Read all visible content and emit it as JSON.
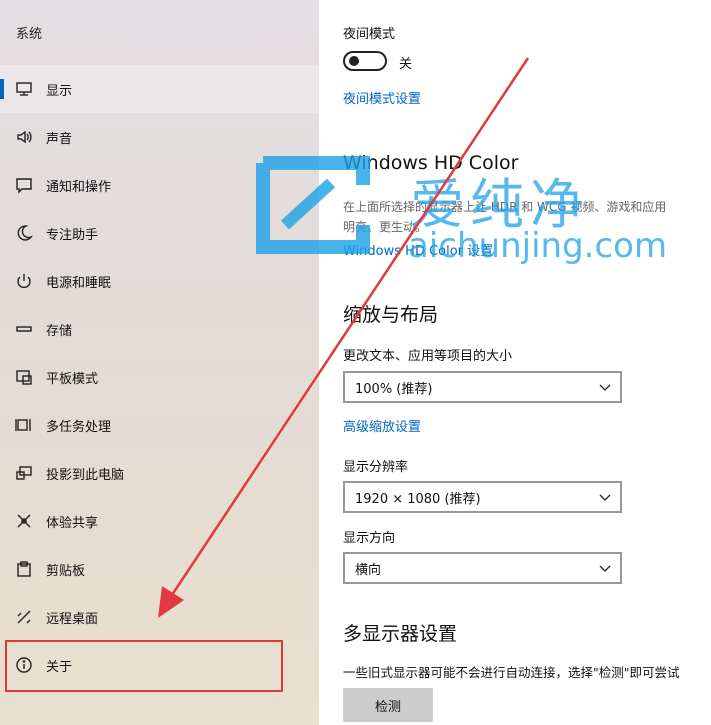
{
  "sidebar": {
    "title": "系统",
    "items": [
      {
        "label": "显示",
        "icon": "monitor-icon"
      },
      {
        "label": "声音",
        "icon": "speaker-icon"
      },
      {
        "label": "通知和操作",
        "icon": "notification-icon"
      },
      {
        "label": "专注助手",
        "icon": "moon-icon"
      },
      {
        "label": "电源和睡眠",
        "icon": "power-icon"
      },
      {
        "label": "存储",
        "icon": "storage-icon"
      },
      {
        "label": "平板模式",
        "icon": "tablet-icon"
      },
      {
        "label": "多任务处理",
        "icon": "multitask-icon"
      },
      {
        "label": "投影到此电脑",
        "icon": "project-icon"
      },
      {
        "label": "体验共享",
        "icon": "share-icon"
      },
      {
        "label": "剪贴板",
        "icon": "clipboard-icon"
      },
      {
        "label": "远程桌面",
        "icon": "remote-desktop-icon"
      },
      {
        "label": "关于",
        "icon": "info-icon"
      }
    ],
    "active_index": 0
  },
  "main": {
    "night_light": {
      "label": "夜间模式",
      "state_label": "关",
      "settings_link": "夜间模式设置"
    },
    "hd_color": {
      "heading": "Windows HD Color",
      "description_line1": "在上面所选择的显示器上让 HDR 和 WCG 视频、游戏和应用",
      "description_line2": "明亮、更生动。",
      "settings_link": "Windows HD Color 设置"
    },
    "scale_layout": {
      "heading": "缩放与布局",
      "text_size_label": "更改文本、应用等项目的大小",
      "text_size_value": "100% (推荐)",
      "advanced_link": "高级缩放设置",
      "resolution_label": "显示分辨率",
      "resolution_value": "1920 × 1080 (推荐)",
      "orientation_label": "显示方向",
      "orientation_value": "横向"
    },
    "multi_display": {
      "heading": "多显示器设置",
      "description": "一些旧式显示器可能不会进行自动连接，选择\"检测\"即可尝试",
      "detect_button": "检测"
    }
  },
  "watermark": {
    "brand": "爱纯净",
    "domain": "aichunjing.com"
  },
  "colors": {
    "accent": "#0067c0",
    "annotation": "#e0393e"
  }
}
